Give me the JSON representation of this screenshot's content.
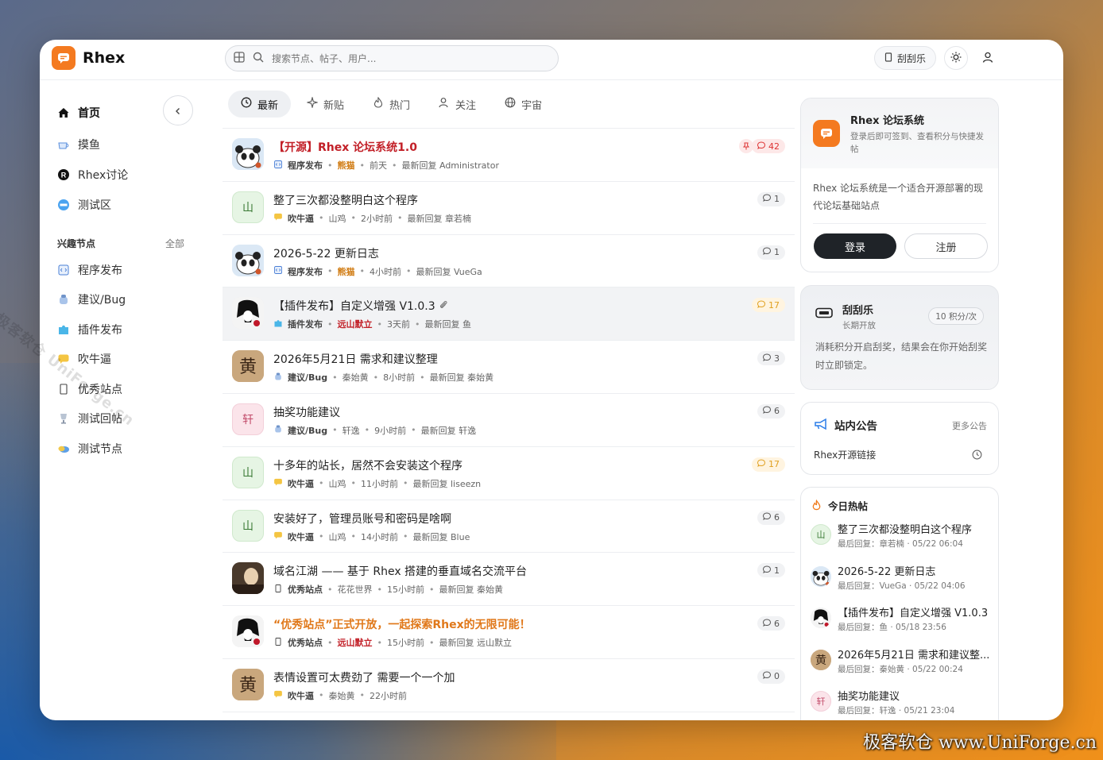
{
  "app": {
    "brand": "Rhex"
  },
  "search": {
    "placeholder": "搜索节点、帖子、用户..."
  },
  "topbar": {
    "scratch_label": "刮刮乐"
  },
  "sidebar": {
    "items": [
      {
        "label": "首页",
        "icon": "home-icon"
      },
      {
        "label": "摸鱼",
        "icon": "cup-icon"
      },
      {
        "label": "Rhex讨论",
        "icon": "r-badge-icon"
      },
      {
        "label": "测试区",
        "icon": "test-badge-icon"
      }
    ],
    "section_title": "兴趣节点",
    "section_all": "全部",
    "nodes": [
      {
        "label": "程序发布",
        "icon": "code-icon"
      },
      {
        "label": "建议/Bug",
        "icon": "bug-icon"
      },
      {
        "label": "插件发布",
        "icon": "puzzle-icon"
      },
      {
        "label": "吹牛逼",
        "icon": "chat-icon"
      },
      {
        "label": "优秀站点",
        "icon": "site-icon"
      },
      {
        "label": "测试回帖",
        "icon": "trophy-icon"
      },
      {
        "label": "测试节点",
        "icon": "cloud-icon"
      }
    ]
  },
  "tabs": [
    {
      "label": "最新",
      "icon": "clock-icon",
      "active": true
    },
    {
      "label": "新贴",
      "icon": "sparkle-icon"
    },
    {
      "label": "热门",
      "icon": "fire-icon"
    },
    {
      "label": "关注",
      "icon": "user-follow-icon"
    },
    {
      "label": "宇宙",
      "icon": "globe-icon"
    }
  ],
  "posts": [
    {
      "title": "【开源】Rhex 论坛系统1.0",
      "style": "red",
      "node": "程序发布",
      "author": "熊猫",
      "author_style": "orange",
      "time": "前天",
      "reply": "最新回复 Administrator",
      "count": "42",
      "count_style": "hot",
      "pinned": true,
      "avatar": "panda"
    },
    {
      "title": "整了三次都没整明白这个程序",
      "node": "吹牛逼",
      "author": "山鸡",
      "time": "2小时前",
      "reply": "最新回复 章若楠",
      "count": "1",
      "avatar": "山"
    },
    {
      "title": "2026-5-22 更新日志",
      "node": "程序发布",
      "author": "熊猫",
      "author_style": "orange",
      "time": "4小时前",
      "reply": "最新回复 VueGa",
      "count": "1",
      "avatar": "panda"
    },
    {
      "title": "【插件发布】自定义增强 V1.0.3",
      "node": "插件发布",
      "author": "远山默立",
      "author_style": "red",
      "time": "3天前",
      "reply": "最新回复 鱼",
      "count": "17",
      "count_style": "warm",
      "attach": true,
      "avatar": "anime",
      "highlight": true
    },
    {
      "title": "2026年5月21日 需求和建议整理",
      "node": "建议/Bug",
      "author": "秦始黄",
      "time": "8小时前",
      "reply": "最新回复 秦始黄",
      "count": "3",
      "avatar": "seal"
    },
    {
      "title": "抽奖功能建议",
      "node": "建议/Bug",
      "author": "轩逸",
      "time": "9小时前",
      "reply": "最新回复 轩逸",
      "count": "6",
      "avatar": "轩"
    },
    {
      "title": "十多年的站长，居然不会安装这个程序",
      "node": "吹牛逼",
      "author": "山鸡",
      "time": "11小时前",
      "reply": "最新回复 liseezn",
      "count": "17",
      "count_style": "warm",
      "avatar": "山"
    },
    {
      "title": "安装好了，管理员账号和密码是啥啊",
      "node": "吹牛逼",
      "author": "山鸡",
      "time": "14小时前",
      "reply": "最新回复 Blue",
      "count": "6",
      "avatar": "山"
    },
    {
      "title": "域名江湖 —— 基于 Rhex 搭建的垂直域名交流平台",
      "node": "优秀站点",
      "author": "花花世界",
      "time": "15小时前",
      "reply": "最新回复 秦始黄",
      "count": "1",
      "avatar": "photo"
    },
    {
      "title": "“优秀站点”正式开放，一起探索Rhex的无限可能！",
      "style": "orange",
      "node": "优秀站点",
      "author": "远山默立",
      "author_style": "red",
      "time": "15小时前",
      "reply": "最新回复 远山默立",
      "count": "6",
      "avatar": "anime"
    },
    {
      "title": "表情设置可太费劲了 需要一个一个加",
      "node": "吹牛逼",
      "author": "秦始黄",
      "time": "22小时前",
      "reply": "",
      "count": "0",
      "avatar": "seal"
    }
  ],
  "login_card": {
    "title": "Rhex 论坛系统",
    "subtitle": "登录后即可签到、查看积分与快捷发帖",
    "desc": "Rhex 论坛系统是一个适合开源部署的现代论坛基础站点",
    "login": "登录",
    "register": "注册"
  },
  "scratch_card": {
    "title": "刮刮乐",
    "subtitle": "长期开放",
    "badge": "10 积分/次",
    "desc": "消耗积分开启刮奖，结果会在你开始刮奖时立即锁定。"
  },
  "notice_card": {
    "title": "站内公告",
    "more": "更多公告",
    "item": "Rhex开源链接"
  },
  "hot_card": {
    "title": "今日热帖",
    "items": [
      {
        "title": "整了三次都没整明白这个程序",
        "meta": "最后回复：章若楠 · 05/22 06:04",
        "avatar": "山"
      },
      {
        "title": "2026-5-22 更新日志",
        "meta": "最后回复：VueGa · 05/22 04:06",
        "avatar": "panda"
      },
      {
        "title": "【插件发布】自定义增强 V1.0.3",
        "meta": "最后回复：鱼 · 05/18 23:56",
        "avatar": "anime"
      },
      {
        "title": "2026年5月21日 需求和建议整...",
        "meta": "最后回复：秦始黄 · 05/22 00:24",
        "avatar": "seal"
      },
      {
        "title": "抽奖功能建议",
        "meta": "最后回复：轩逸 · 05/21 23:04",
        "avatar": "轩"
      }
    ]
  },
  "watermarks": {
    "diagonal": "极客软仓 UniForge.cn",
    "corner": "极客软仓 www.UniForge.cn"
  }
}
